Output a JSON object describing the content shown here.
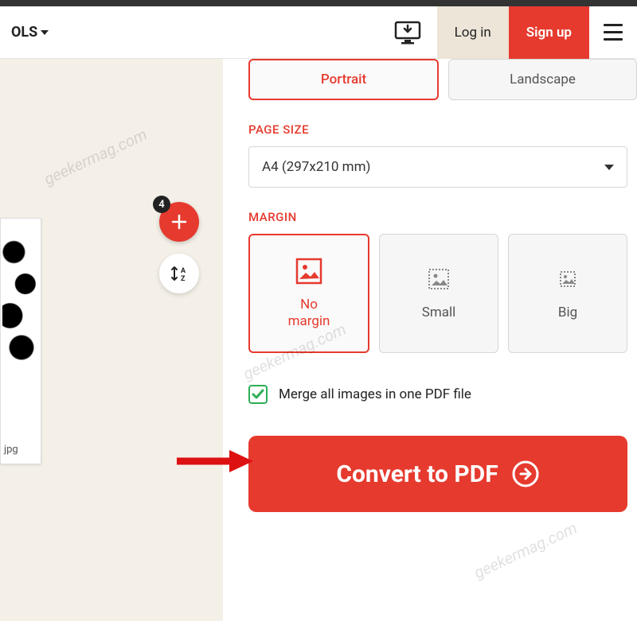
{
  "header": {
    "tools_label": "OLS",
    "login_label": "Log in",
    "signup_label": "Sign up"
  },
  "left": {
    "add_badge": "4",
    "thumb_caption": "jpg"
  },
  "orientation": {
    "portrait": "Portrait",
    "landscape": "Landscape"
  },
  "page_size": {
    "label": "PAGE SIZE",
    "selected": "A4 (297x210 mm)"
  },
  "margin": {
    "label": "MARGIN",
    "no_margin": "No\nmargin",
    "small": "Small",
    "big": "Big"
  },
  "merge": {
    "label": "Merge all images in one PDF file"
  },
  "convert": {
    "label": "Convert to PDF"
  },
  "watermark": "geekermag.com"
}
